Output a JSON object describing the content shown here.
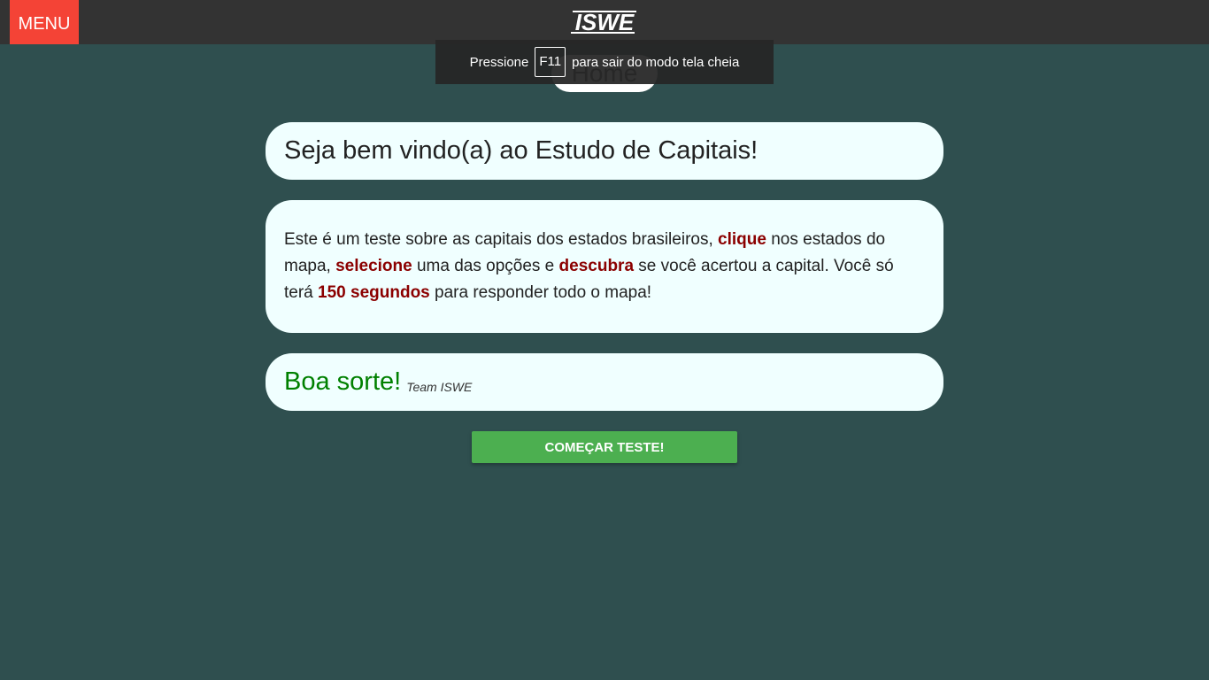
{
  "topbar": {
    "menu_label": "MENU",
    "logo_text": "ISWE"
  },
  "nav": {
    "home_label": "Home"
  },
  "fullscreen_notice": {
    "before": "Pressione",
    "key": "F11",
    "after": "para sair do modo tela cheia"
  },
  "welcome": {
    "title": "Seja bem vindo(a) ao Estudo de Capitais!"
  },
  "instructions": {
    "part1": "Este é um teste sobre as capitais dos estados brasileiros, ",
    "hl1": "clique",
    "part2": " nos estados do mapa, ",
    "hl2": "selecione",
    "part3": " uma das opções e ",
    "hl3": "descubra",
    "part4": " se você acertou a capital. Você só terá ",
    "hl4": "150 segundos",
    "part5": " para responder todo o mapa!"
  },
  "luck": {
    "text": "Boa sorte!",
    "signature": "Team ISWE"
  },
  "start_button": {
    "label": "COMEÇAR TESTE!"
  },
  "colors": {
    "background": "#2f4f4f",
    "topbar": "#333333",
    "menu": "#f44336",
    "card": "#f0ffff",
    "highlight": "#8b0000",
    "luck": "#008000",
    "start": "#4caf50"
  }
}
